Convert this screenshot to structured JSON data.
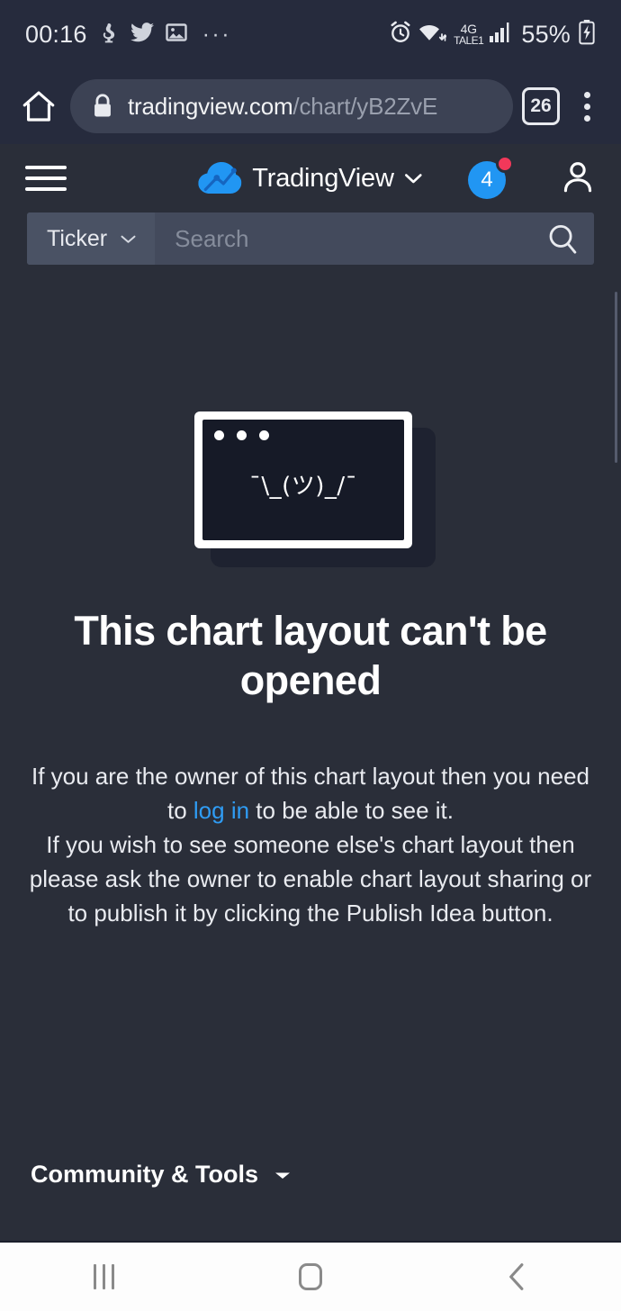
{
  "statusbar": {
    "clock": "00:16",
    "notification_icons": [
      "app-icon",
      "twitter-icon",
      "gallery-icon"
    ],
    "overflow": "···",
    "alarm_icon": "alarm-icon",
    "wifi_icon": "wifi-icon",
    "network_type": "4G",
    "carrier": "TALE1",
    "signal_icon": "signal-bars-icon",
    "battery_percent": "55%",
    "battery_icon": "battery-charging-icon"
  },
  "browser": {
    "home_icon": "home-icon",
    "lock_icon": "lock-icon",
    "url_domain": "tradingview.com",
    "url_path": "/chart/yB2ZvE",
    "tab_count": "26",
    "menu_icon": "kebab-menu-icon"
  },
  "header": {
    "menu_icon": "hamburger-menu-icon",
    "logo_icon": "tradingview-cloud-logo",
    "brand": "TradingView",
    "brand_chevron": "chevron-down-icon",
    "notifications_count": "4",
    "notifications_dot": true,
    "account_icon": "user-account-icon"
  },
  "search": {
    "filter_label": "Ticker",
    "filter_chevron": "chevron-down-icon",
    "placeholder": "Search",
    "submit_icon": "search-icon"
  },
  "error": {
    "illustration": "broken-window-shrug-illustration",
    "shrug": "¯\\_(ツ)_/¯",
    "title": "This chart layout can't be opened",
    "paragraph1_before": "If you are the owner of this chart layout then you need to ",
    "paragraph1_link": "log in",
    "paragraph1_after": " to be able to see it.",
    "paragraph2": "If you wish to see someone else's chart layout then please ask the owner to enable chart layout sharing or to publish it by clicking the Publish Idea button."
  },
  "footer": {
    "label": "Community & Tools",
    "chevron": "chevron-down-icon"
  },
  "navbar": {
    "recent_icon": "recent-apps-icon",
    "home_icon": "home-button-icon",
    "back_icon": "back-chevron-icon"
  },
  "colors": {
    "page_bg": "#2a2e39",
    "chrome_bg": "#262b3d",
    "accent_blue": "#2196f3",
    "link_blue": "#2f9cf4",
    "badge_red": "#f2385a",
    "search_bg": "#434a5c"
  }
}
